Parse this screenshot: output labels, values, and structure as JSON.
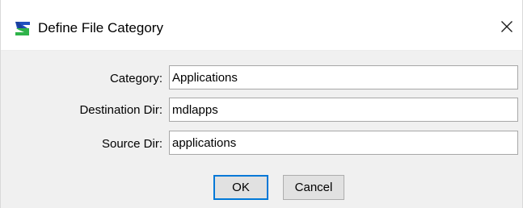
{
  "window": {
    "title": "Define File Category",
    "icon": "app-logo-icon",
    "close_icon": "close-icon"
  },
  "form": {
    "category": {
      "label": "Category:",
      "value": "Applications"
    },
    "destination_dir": {
      "label": "Destination Dir:",
      "value": "mdlapps"
    },
    "source_dir": {
      "label": "Source Dir:",
      "value": "applications"
    }
  },
  "buttons": {
    "ok": "OK",
    "cancel": "Cancel"
  },
  "colors": {
    "accent": "#0078d7",
    "logo_blue": "#1f4fbf",
    "logo_green": "#2fb34a"
  }
}
